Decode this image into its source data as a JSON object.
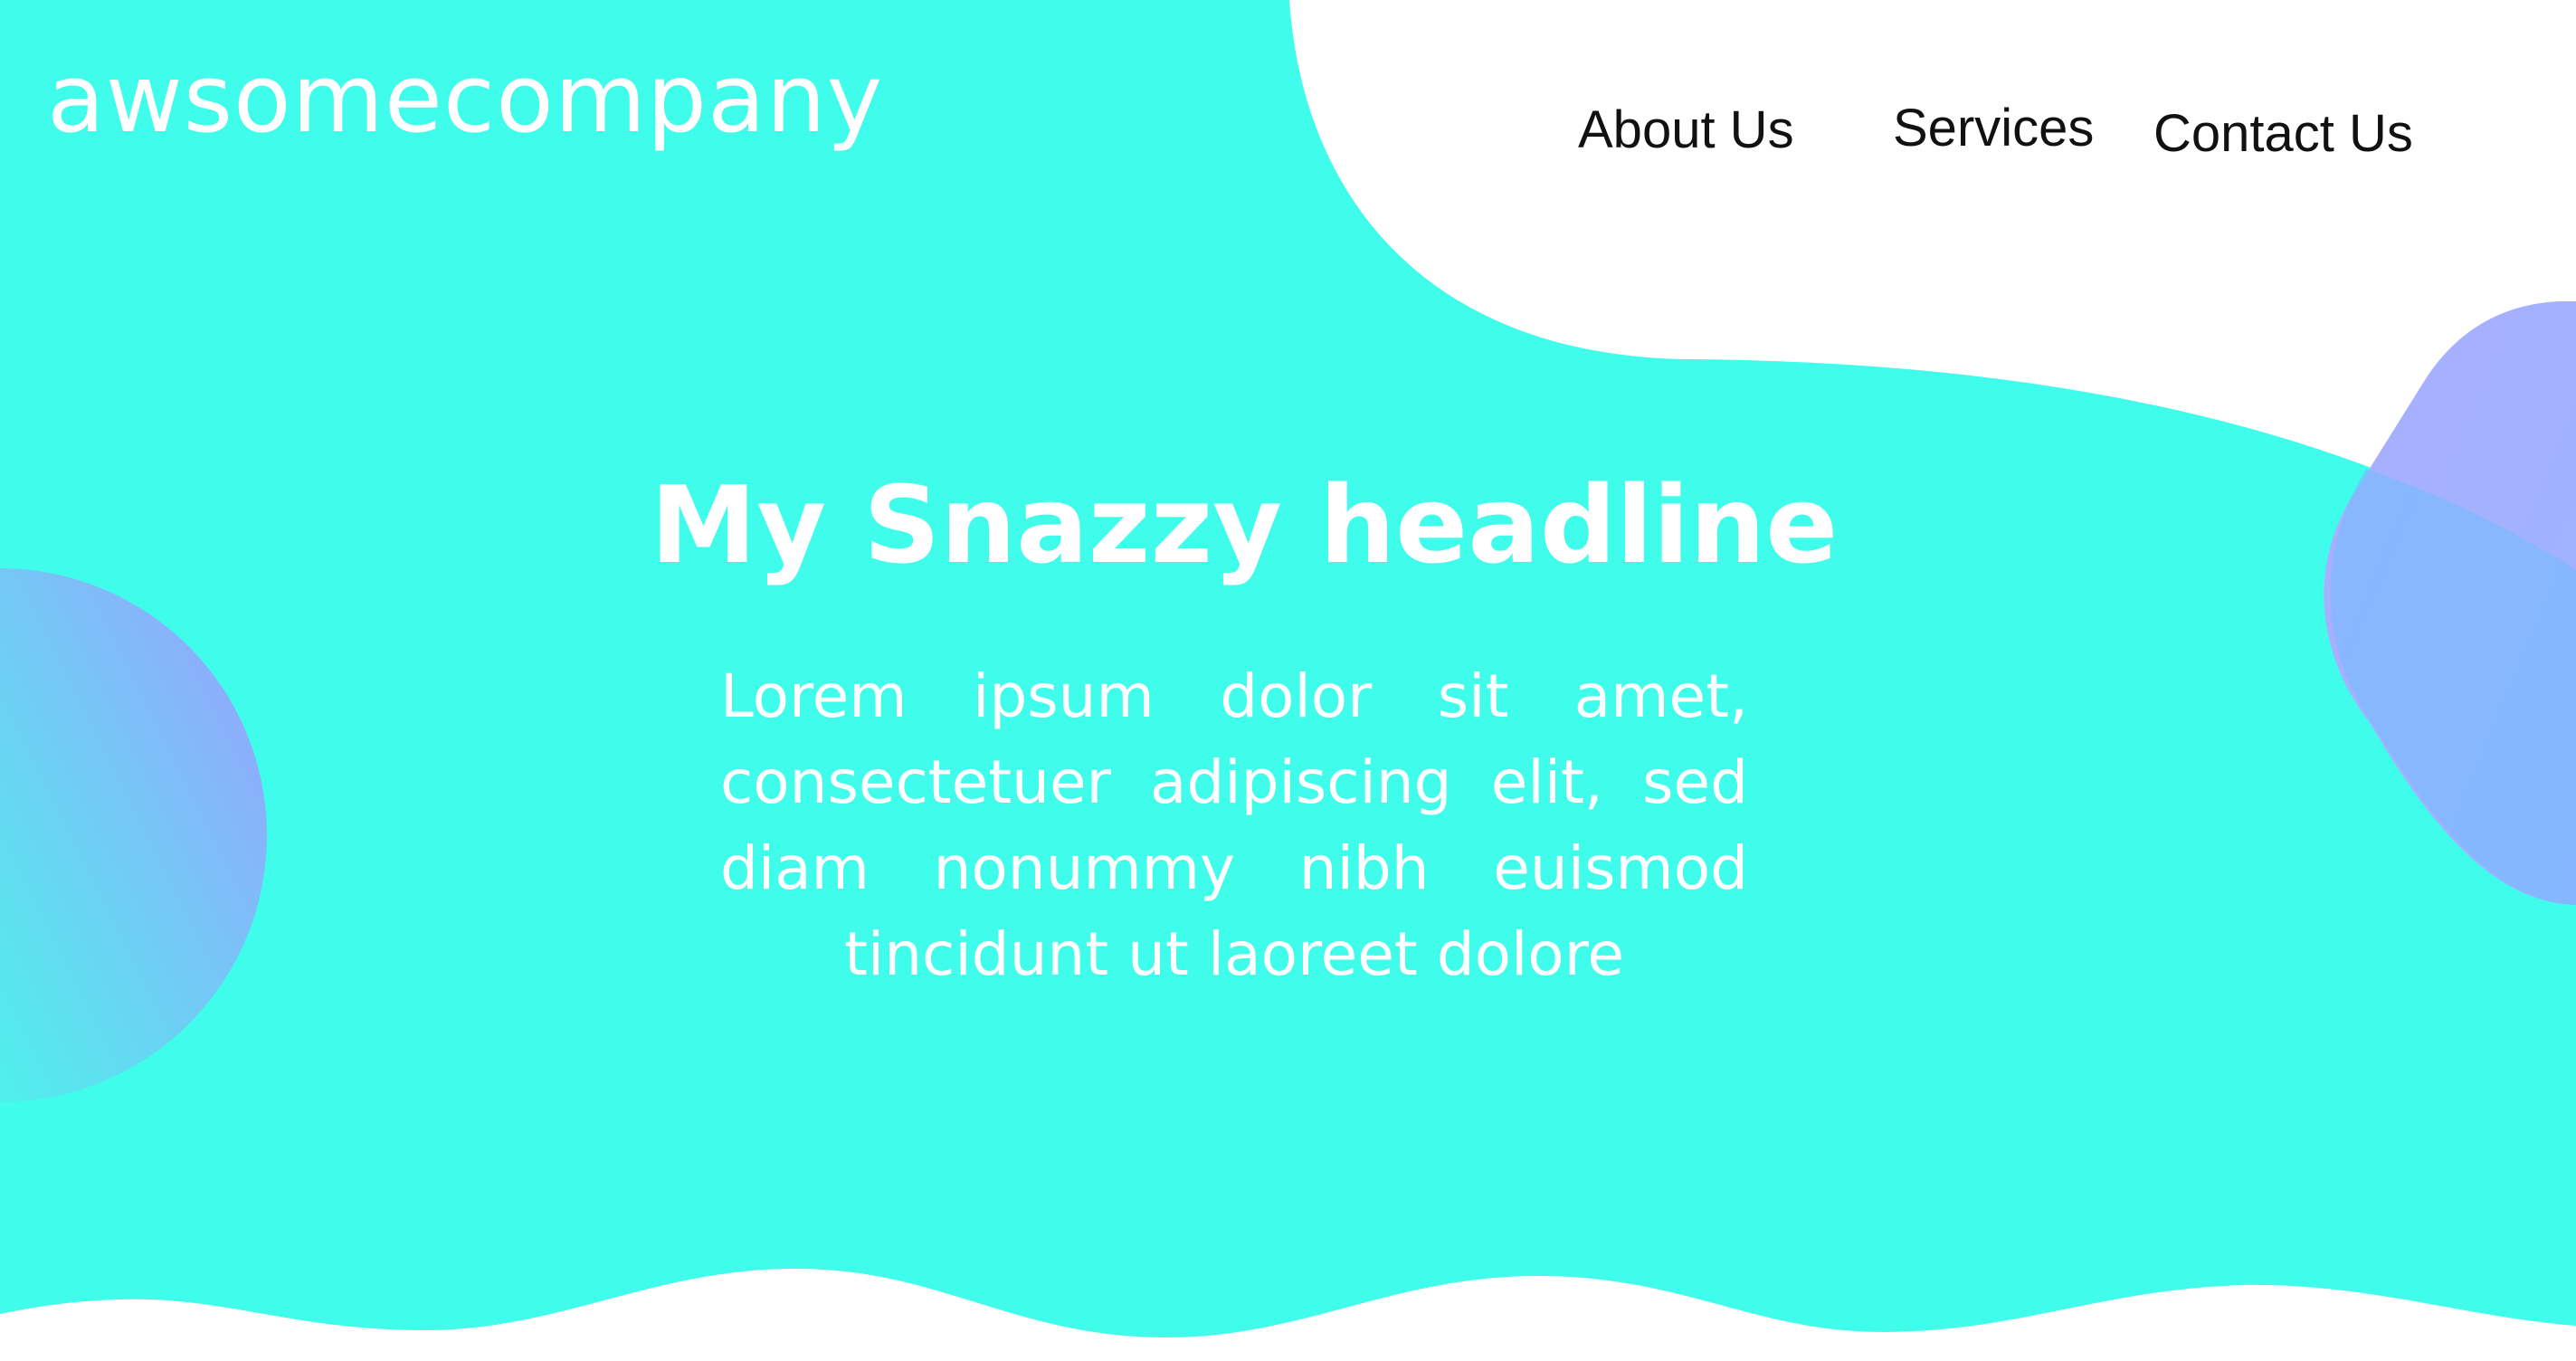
{
  "brand": {
    "logo_text": "awsomecompany"
  },
  "nav": {
    "items": [
      {
        "label": "About Us"
      },
      {
        "label": "Services"
      },
      {
        "label": "Contact Us"
      }
    ]
  },
  "hero": {
    "headline": "My Snazzy headline",
    "body": "Lorem ipsum dolor sit amet, consectetuer adipiscing elit, sed diam nonummy nibh euismod tincidunt ut laoreet dolore"
  },
  "colors": {
    "background_primary": "#40FCEA",
    "background_secondary": "#FFFFFF",
    "blob_purple": "#A3A5FF",
    "blob_blue": "#6FBCFF",
    "text_light": "#FFFFFF",
    "text_dark": "#111111"
  }
}
